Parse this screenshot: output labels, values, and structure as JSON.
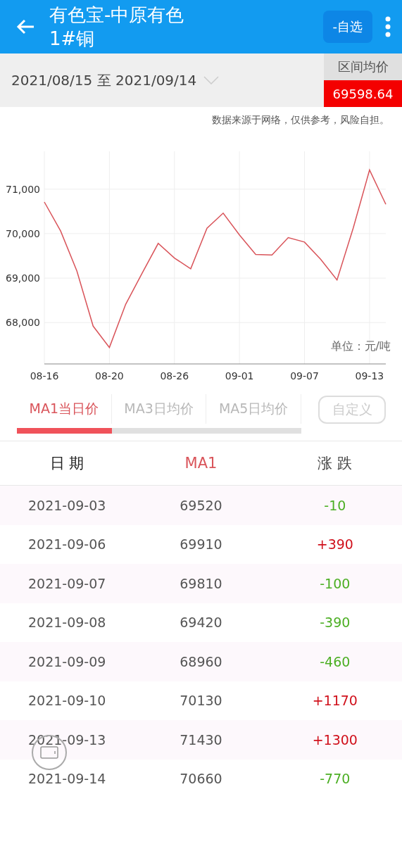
{
  "app_bar": {
    "title_line_1": "有色宝-中原有色",
    "title_line_2": "1#铜",
    "watch_button": "-自选"
  },
  "date_range": {
    "text": "2021/08/15 至 2021/09/14",
    "average_label": "区间均价",
    "average_value": "69598.64"
  },
  "disclaimer": "数据来源于网络，仅供参考，风险自担。",
  "chart": {
    "unit": "单位：元/吨",
    "chart_data": {
      "type": "line",
      "grid": true,
      "categories": [
        "08-16",
        null,
        null,
        null,
        "08-20",
        null,
        null,
        null,
        "08-26",
        null,
        null,
        null,
        "09-01",
        null,
        null,
        null,
        "09-07",
        null,
        null,
        null,
        "09-13",
        null
      ],
      "series": [
        {
          "color": "#d9545a",
          "values": [
            70710,
            70060,
            69160,
            67920,
            67440,
            68410,
            69100,
            69780,
            69450,
            69210,
            70120,
            70460,
            69970,
            69530,
            69520,
            69910,
            69810,
            69420,
            68960,
            70130,
            71430,
            70660
          ]
        }
      ],
      "ylim": [
        67070,
        71850
      ],
      "yticks": [
        {
          "value": 68000,
          "label": "68,000"
        },
        {
          "value": 69000,
          "label": "69,000"
        },
        {
          "value": 70000,
          "label": "70,000"
        },
        {
          "value": 71000,
          "label": "71,000"
        }
      ]
    }
  },
  "tabs": [
    {
      "label": "MA1当日价",
      "selected": true
    },
    {
      "label": "MA3日均价",
      "selected": false
    },
    {
      "label": "MA5日均价",
      "selected": false
    }
  ],
  "custom_button": "自定义",
  "table": {
    "columns": [
      "日 期",
      "MA1",
      "涨 跌"
    ],
    "rows": [
      {
        "date": "2021-09-03",
        "ma1": "69520",
        "change": "-10",
        "color": "#4caf24"
      },
      {
        "date": "2021-09-06",
        "ma1": "69910",
        "change": "+390",
        "color": "#d0101b"
      },
      {
        "date": "2021-09-07",
        "ma1": "69810",
        "change": "-100",
        "color": "#4caf24"
      },
      {
        "date": "2021-09-08",
        "ma1": "69420",
        "change": "-390",
        "color": "#4caf24"
      },
      {
        "date": "2021-09-09",
        "ma1": "68960",
        "change": "-460",
        "color": "#4caf24"
      },
      {
        "date": "2021-09-10",
        "ma1": "70130",
        "change": "+1170",
        "color": "#d0101b"
      },
      {
        "date": "2021-09-13",
        "ma1": "71430",
        "change": "+1300",
        "color": "#d0101b"
      },
      {
        "date": "2021-09-14",
        "ma1": "70660",
        "change": "-770",
        "color": "#4caf24"
      }
    ]
  }
}
